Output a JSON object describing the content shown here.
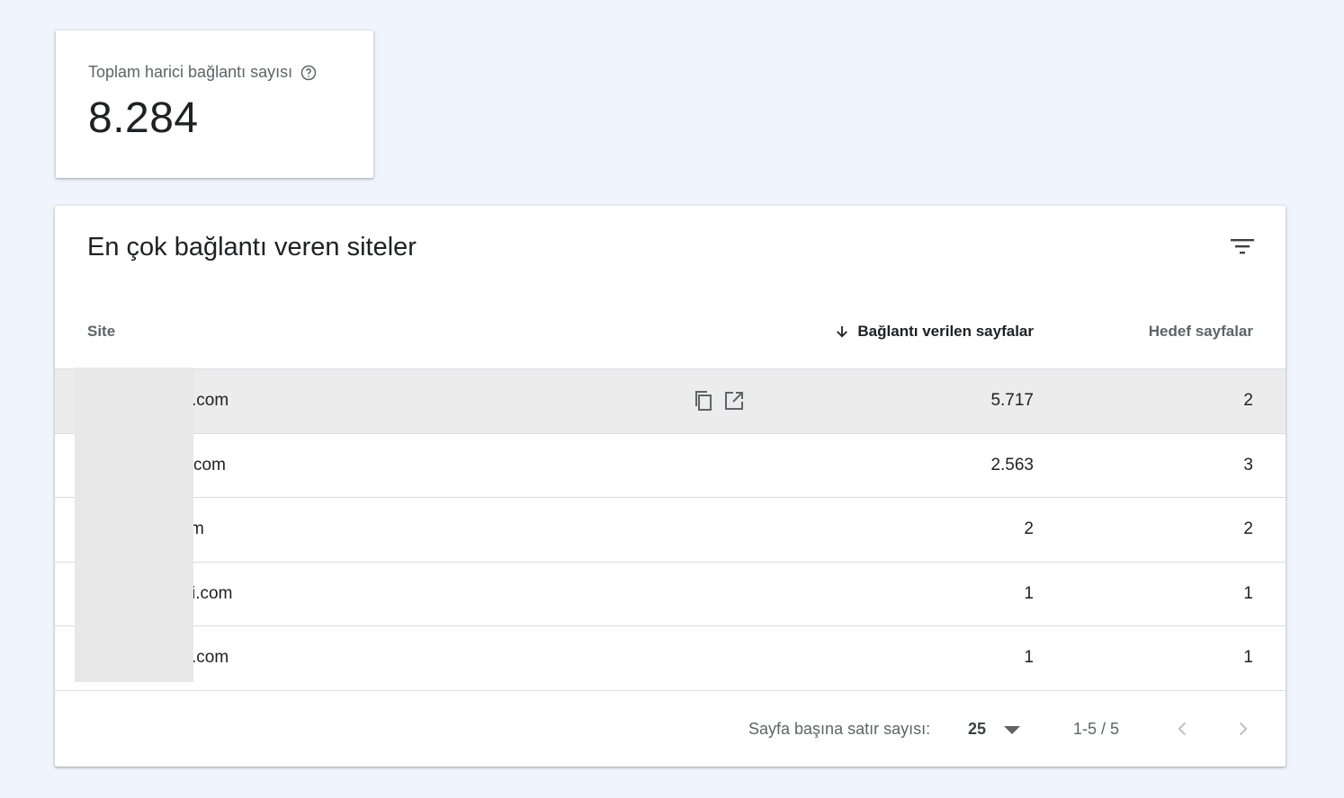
{
  "stat": {
    "label": "Toplam harici bağlantı sayısı",
    "value": "8.284"
  },
  "table": {
    "title": "En çok bağlantı veren siteler",
    "headers": {
      "site": "Site",
      "linking_pages": "Bağlantı verilen sayfalar",
      "target_pages": "Hedef sayfalar"
    },
    "rows": [
      {
        "site": ".com",
        "linking_pages": "5.717",
        "target_pages": "2"
      },
      {
        "site": "com",
        "linking_pages": "2.563",
        "target_pages": "3"
      },
      {
        "site": "m",
        "linking_pages": "2",
        "target_pages": "2"
      },
      {
        "site": "i.com",
        "linking_pages": "1",
        "target_pages": "1"
      },
      {
        "site": ".com",
        "linking_pages": "1",
        "target_pages": "1"
      }
    ]
  },
  "footer": {
    "rows_per_page_label": "Sayfa başına satır sayısı:",
    "rows_per_page_value": "25",
    "range": "1-5 / 5"
  },
  "icons": {
    "help": "help-circle-icon",
    "filter": "filter-icon",
    "sort": "arrow-down-icon",
    "copy": "copy-icon",
    "open": "open-in-new-icon",
    "prev": "chevron-left-icon",
    "next": "chevron-right-icon"
  },
  "colors": {
    "background": "#f0f4fc",
    "card": "#ffffff",
    "hover_row": "#ececec",
    "text_primary": "#202124",
    "text_secondary": "#5f6368"
  }
}
